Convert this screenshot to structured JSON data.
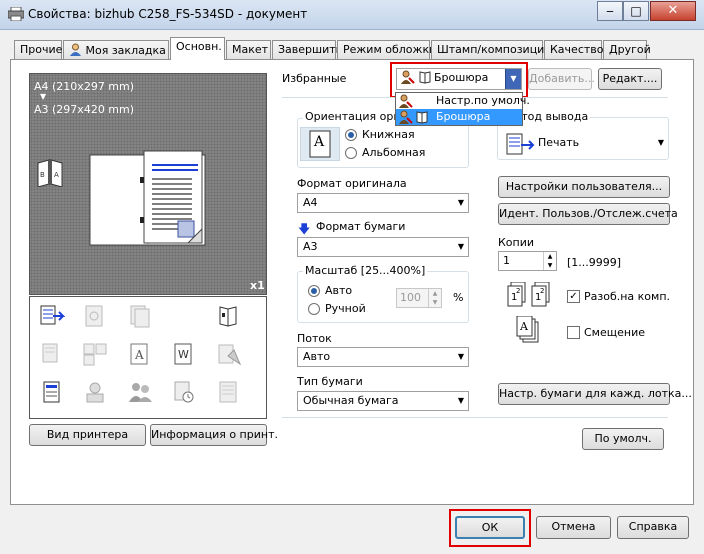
{
  "window": {
    "title": "Свойства: bizhub C258_FS-534SD - документ",
    "minimize": "‒",
    "maximize": "□",
    "close": "✕"
  },
  "tabs": [
    "Прочие",
    "Моя закладка",
    "Основн.",
    "Макет",
    "Завершить",
    "Режим обложки",
    "Штамп/композиция",
    "Качество",
    "Другой"
  ],
  "preview": {
    "paper_original": "A4 (210x297 mm)",
    "arrow": "▼",
    "paper_output": "A3 (297x420 mm)",
    "copies_badge": "x1"
  },
  "left_buttons": {
    "printer_view": "Вид принтера",
    "printer_info": "Информация о принт."
  },
  "favorites": {
    "label": "Избранные",
    "selected": "Брошюра",
    "add": "Добавить...",
    "edit": "Редакт....",
    "options": [
      "Настр.по умолч.",
      "Брошюра"
    ]
  },
  "orientation": {
    "title": "Ориентация оригинала",
    "portrait": "Книжная",
    "landscape": "Альбомная",
    "icon_letter": "A"
  },
  "original_size": {
    "label": "Формат оригинала",
    "value": "A4"
  },
  "paper_size": {
    "label": "Формат бумаги",
    "value": "A3"
  },
  "zoom": {
    "title": "Масштаб [25...400%]",
    "auto": "Авто",
    "manual": "Ручной",
    "value": "100",
    "unit": "%"
  },
  "tray": {
    "label": "Поток",
    "value": "Авто"
  },
  "paper_type": {
    "label": "Тип бумаги",
    "value": "Обычная бумага"
  },
  "output": {
    "title": "Метод вывода",
    "value": "Печать"
  },
  "user_settings": "Настройки пользователя...",
  "user_auth": "Идент. Пользов./Отслеж.счета",
  "copies": {
    "label": "Копии",
    "value": "1",
    "range": "[1...9999]",
    "collate": "Разоб.на комп.",
    "offset": "Смещение"
  },
  "tray_settings": "Настр. бумаги для кажд. лотка...",
  "defaults": "По умолч.",
  "footer": {
    "ok": "ОК",
    "cancel": "Отмена",
    "help": "Справка"
  },
  "colors": {
    "highlight": "#e00000",
    "selection": "#3399ff",
    "accent": "#1c3fd6"
  }
}
